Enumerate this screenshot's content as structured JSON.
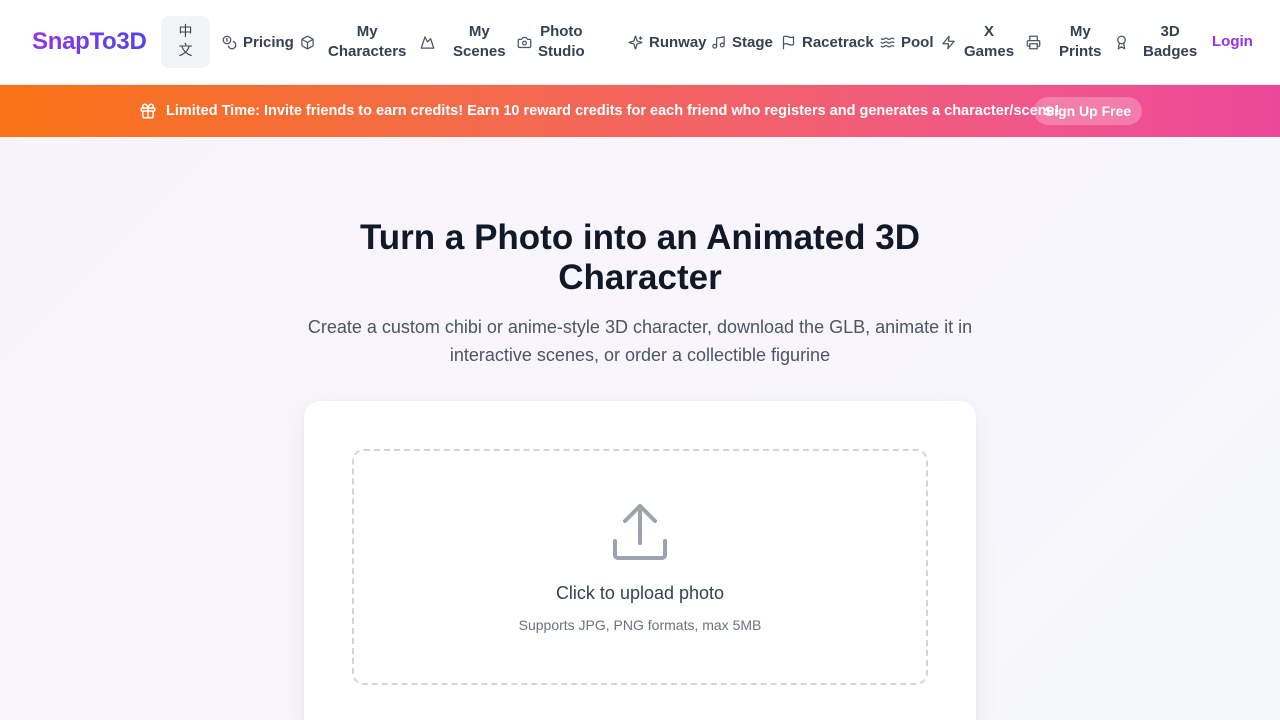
{
  "brand": {
    "logo_text": "SnapTo3D"
  },
  "language": {
    "line1": "中",
    "line2": "文"
  },
  "nav": {
    "pricing": "Pricing",
    "my_characters": [
      "My",
      "Characters"
    ],
    "my_scenes": [
      "My",
      "Scenes"
    ],
    "photo_studio": [
      "Photo",
      "Studio"
    ],
    "runway": "Runway",
    "stage": "Stage",
    "racetrack": "Racetrack",
    "pool": "Pool",
    "x_games": [
      "X",
      "Games"
    ],
    "my_prints": [
      "My",
      "Prints"
    ],
    "badges": [
      "3D",
      "Badges"
    ],
    "login": "Login"
  },
  "banner": {
    "text": "Limited Time: Invite friends to earn credits! Earn 10 reward credits for each friend who registers and generates a character/scene!",
    "cta": "Sign Up Free"
  },
  "hero": {
    "title": "Turn a Photo into an Animated 3D Character",
    "subtitle": "Create a custom chibi or anime-style 3D character, download the GLB, animate it in interactive scenes, or order a collectible figurine"
  },
  "upload": {
    "title": "Click to upload photo",
    "hint": "Supports JPG, PNG formats, max 5MB"
  },
  "colors": {
    "brand_purple": "#9333ea",
    "brand_indigo": "#4f46e5",
    "banner_orange": "#f97316",
    "banner_pink": "#ec4899"
  }
}
